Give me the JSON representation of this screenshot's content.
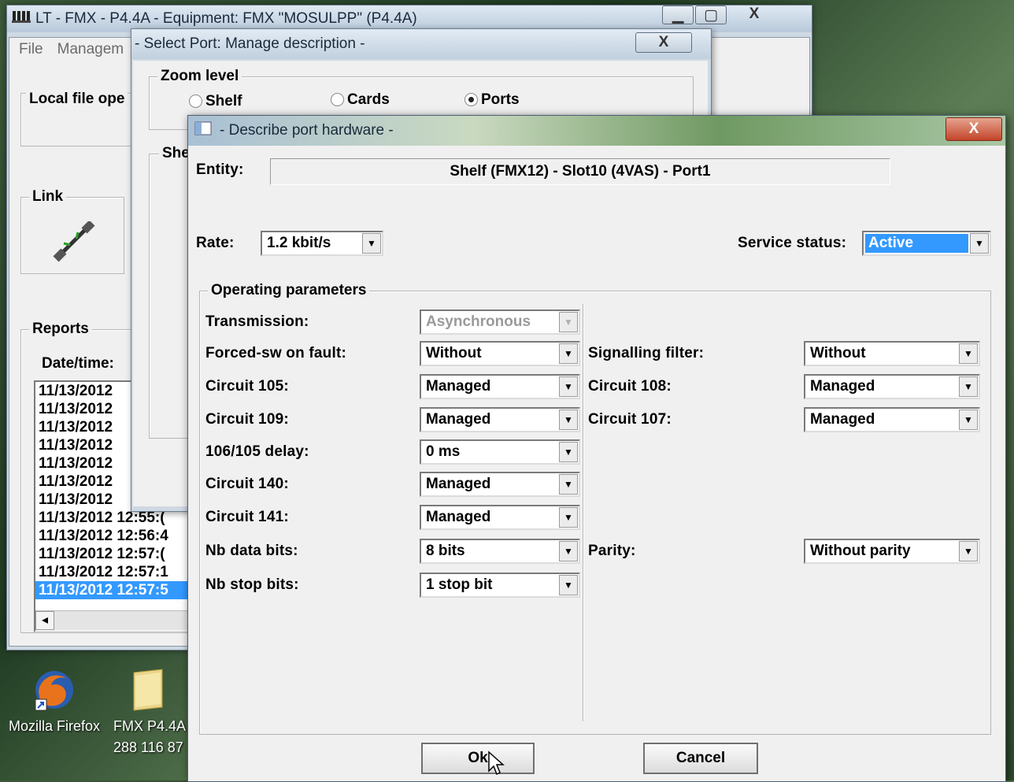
{
  "desktop": {
    "icons": [
      {
        "label": "Mozilla Firefox"
      },
      {
        "label": "FMX P4.4A",
        "sublabel": "288 116 87"
      }
    ]
  },
  "main_window": {
    "title": "LT - FMX - P4.4A - Equipment: FMX \"MOSULPP\" (P4.4A)",
    "menu": [
      "File",
      "Managem"
    ],
    "local_file_group": "Local file ope",
    "link_group": "Link",
    "reports_group": "Reports",
    "date_time_label": "Date/time:",
    "report_rows": [
      "11/13/2012",
      "11/13/2012",
      "11/13/2012",
      "11/13/2012",
      "11/13/2012",
      "11/13/2012",
      "11/13/2012",
      "11/13/2012  12:55:(",
      "11/13/2012  12:56:4",
      "11/13/2012  12:57:(",
      "11/13/2012  12:57:1",
      "11/13/2012  12:57:5"
    ],
    "scroll_left": "◂",
    "buttons": {
      "minimize": "▁",
      "maximize": "▢",
      "close": "X"
    }
  },
  "select_port_dialog": {
    "title": "- Select Port: Manage description -",
    "close": "X",
    "zoom_level": "Zoom level",
    "radios": [
      {
        "label": "Shelf",
        "selected": false
      },
      {
        "label": "Cards",
        "selected": false
      },
      {
        "label": "Ports",
        "selected": true
      }
    ],
    "shelf_group": "She"
  },
  "describe_dialog": {
    "title": "- Describe port hardware -",
    "close": "X",
    "entity_label": "Entity:",
    "entity_value": "Shelf (FMX12) - Slot10 (4VAS) - Port1",
    "rate_label": "Rate:",
    "rate_value": "1.2 kbit/s",
    "service_status_label": "Service status:",
    "service_status_value": "Active",
    "operating_parameters": "Operating parameters",
    "left_params": [
      {
        "label": "Transmission:",
        "value": "Asynchronous",
        "disabled": true
      },
      {
        "label": "Forced-sw on fault:",
        "value": "Without"
      },
      {
        "label": "Circuit 105:",
        "value": "Managed"
      },
      {
        "label": "Circuit 109:",
        "value": "Managed"
      },
      {
        "label": "106/105 delay:",
        "value": "0 ms"
      },
      {
        "label": "Circuit 140:",
        "value": "Managed"
      },
      {
        "label": "Circuit 141:",
        "value": "Managed"
      },
      {
        "label": "Nb data bits:",
        "value": "8 bits"
      },
      {
        "label": "Nb stop bits:",
        "value": "1 stop bit"
      }
    ],
    "right_params": [
      {
        "label": "Signalling filter:",
        "value": "Without"
      },
      {
        "label": "Circuit 108:",
        "value": "Managed"
      },
      {
        "label": "Circuit 107:",
        "value": "Managed"
      },
      {
        "label": "Parity:",
        "value": "Without parity"
      }
    ],
    "ok_label": "Ok",
    "cancel_label": "Cancel",
    "dropdown_arrow": "▼"
  }
}
